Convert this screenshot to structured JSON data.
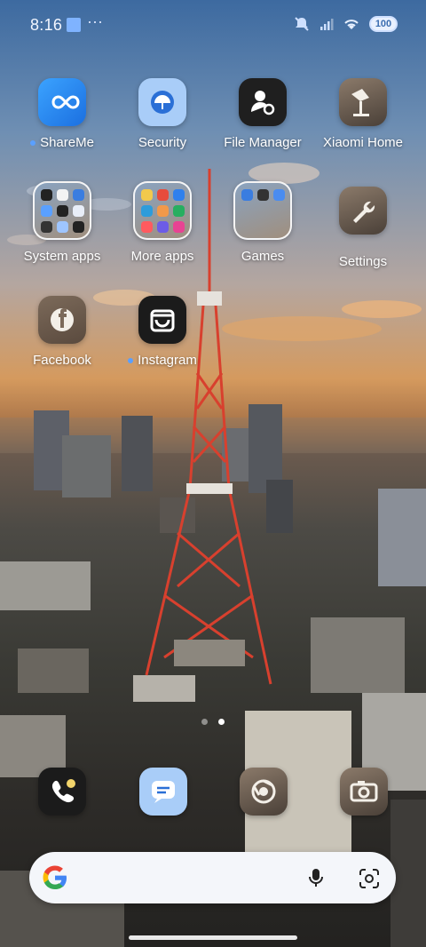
{
  "status_bar": {
    "time": "8:16",
    "more_indicator": "···",
    "battery": "100"
  },
  "apps": {
    "shareme": "ShareMe",
    "security": "Security",
    "file_manager": "File Manager",
    "xiaomi_home": "Xiaomi Home",
    "system_apps": "System apps",
    "more_apps": "More apps",
    "games": "Games",
    "settings": "Settings",
    "facebook": "Facebook",
    "instagram": "Instagram"
  },
  "dock": [
    "phone-icon",
    "messages-icon",
    "chrome-icon",
    "camera-icon"
  ],
  "search": {
    "brand": "Google"
  },
  "colors": {
    "accent": "#5aa0ff",
    "tower": "#d8402e"
  }
}
